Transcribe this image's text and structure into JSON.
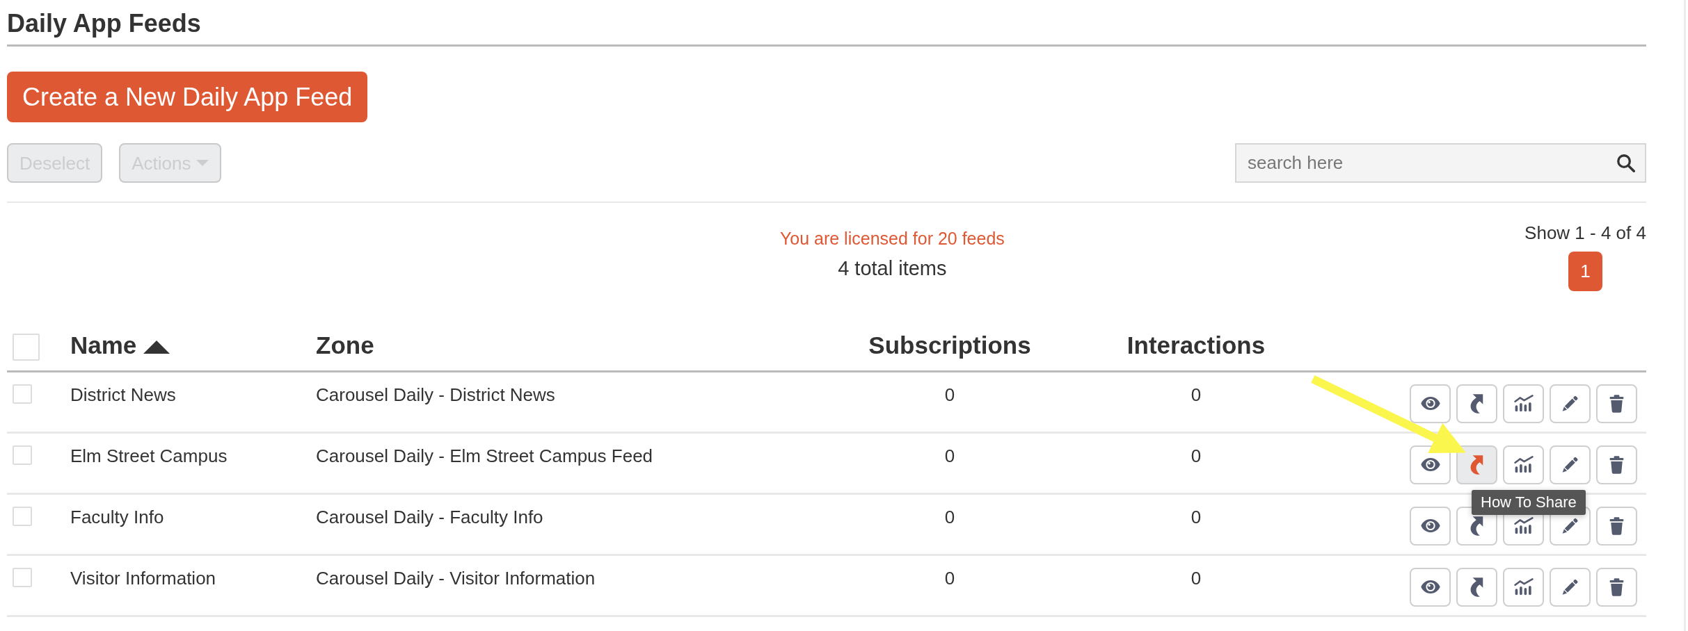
{
  "page": {
    "title": "Daily App Feeds"
  },
  "create_button": {
    "label": "Create a New Daily App Feed"
  },
  "toolbar": {
    "buttons": [
      {
        "label": "Deselect",
        "disabled": true,
        "dropdown": false
      },
      {
        "label": "Actions",
        "disabled": true,
        "dropdown": true
      }
    ],
    "search": {
      "placeholder": "search here"
    }
  },
  "summary": {
    "license_notice": "You are licensed for 20 feeds",
    "total": "4 total items",
    "range": "Show 1 - 4 of 4",
    "pages": [
      {
        "label": "1",
        "selected": true
      }
    ]
  },
  "table": {
    "select_all": {
      "checked": false
    },
    "columns": [
      {
        "label": "Name",
        "sort_ascending": true
      },
      {
        "label": "Zone",
        "sort_ascending": false
      },
      {
        "label": "Subscriptions",
        "sort_ascending": false
      },
      {
        "label": "Interactions",
        "sort_ascending": false
      }
    ],
    "rows": [
      {
        "checked": false,
        "name": "District News",
        "zone": "Carousel Daily - District News",
        "subscriptions": "0",
        "interactions": "0",
        "actions": [
          {
            "kind": "view",
            "highlighted": false
          },
          {
            "kind": "share",
            "highlighted": false
          },
          {
            "kind": "stats",
            "highlighted": false
          },
          {
            "kind": "edit",
            "highlighted": false
          },
          {
            "kind": "delete",
            "highlighted": false
          }
        ]
      },
      {
        "checked": false,
        "name": "Elm Street Campus",
        "zone": "Carousel Daily - Elm Street Campus Feed",
        "subscriptions": "0",
        "interactions": "0",
        "actions": [
          {
            "kind": "view",
            "highlighted": false
          },
          {
            "kind": "share",
            "highlighted": true,
            "tooltip": "How To Share"
          },
          {
            "kind": "stats",
            "highlighted": false
          },
          {
            "kind": "edit",
            "highlighted": false
          },
          {
            "kind": "delete",
            "highlighted": false
          }
        ]
      },
      {
        "checked": false,
        "name": "Faculty Info",
        "zone": "Carousel Daily - Faculty Info",
        "subscriptions": "0",
        "interactions": "0",
        "actions": [
          {
            "kind": "view",
            "highlighted": false
          },
          {
            "kind": "share",
            "highlighted": false
          },
          {
            "kind": "stats",
            "highlighted": false
          },
          {
            "kind": "edit",
            "highlighted": false
          },
          {
            "kind": "delete",
            "highlighted": false
          }
        ]
      },
      {
        "checked": false,
        "name": "Visitor Information",
        "zone": "Carousel Daily - Visitor Information",
        "subscriptions": "0",
        "interactions": "0",
        "actions": [
          {
            "kind": "view",
            "highlighted": false
          },
          {
            "kind": "share",
            "highlighted": false
          },
          {
            "kind": "stats",
            "highlighted": false
          },
          {
            "kind": "edit",
            "highlighted": false
          },
          {
            "kind": "delete",
            "highlighted": false
          }
        ]
      }
    ]
  }
}
